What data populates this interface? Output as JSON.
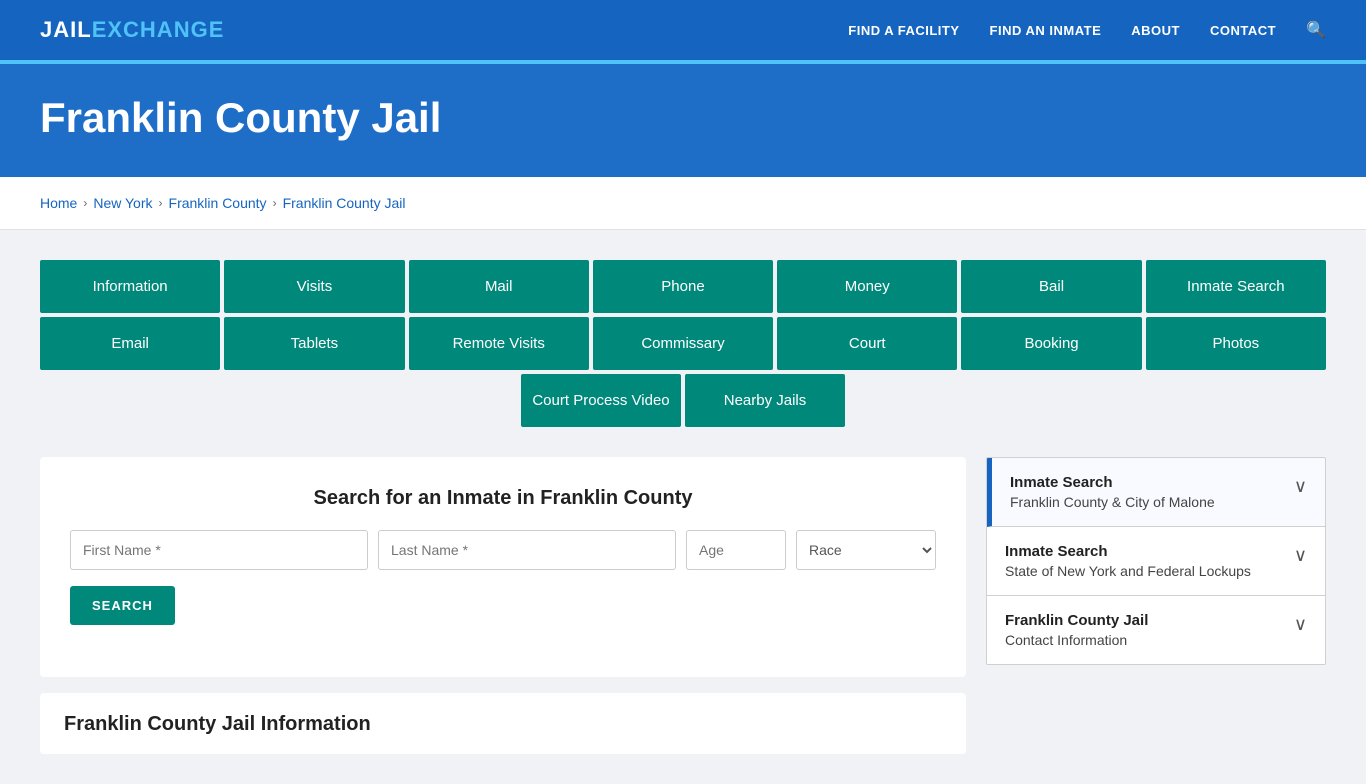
{
  "brand": {
    "jail": "JAIL",
    "exchange": "EXCHANGE"
  },
  "nav": {
    "links": [
      {
        "id": "find-facility",
        "label": "FIND A FACILITY"
      },
      {
        "id": "find-inmate",
        "label": "FIND AN INMATE"
      },
      {
        "id": "about",
        "label": "ABOUT"
      },
      {
        "id": "contact",
        "label": "CONTACT"
      }
    ]
  },
  "hero": {
    "title": "Franklin County Jail"
  },
  "breadcrumb": {
    "items": [
      {
        "id": "home",
        "label": "Home"
      },
      {
        "id": "new-york",
        "label": "New York"
      },
      {
        "id": "franklin-county",
        "label": "Franklin County"
      },
      {
        "id": "franklin-county-jail",
        "label": "Franklin County Jail"
      }
    ]
  },
  "grid_buttons": {
    "row1": [
      {
        "id": "information",
        "label": "Information"
      },
      {
        "id": "visits",
        "label": "Visits"
      },
      {
        "id": "mail",
        "label": "Mail"
      },
      {
        "id": "phone",
        "label": "Phone"
      },
      {
        "id": "money",
        "label": "Money"
      },
      {
        "id": "bail",
        "label": "Bail"
      },
      {
        "id": "inmate-search",
        "label": "Inmate Search"
      }
    ],
    "row2": [
      {
        "id": "email",
        "label": "Email"
      },
      {
        "id": "tablets",
        "label": "Tablets"
      },
      {
        "id": "remote-visits",
        "label": "Remote Visits"
      },
      {
        "id": "commissary",
        "label": "Commissary"
      },
      {
        "id": "court",
        "label": "Court"
      },
      {
        "id": "booking",
        "label": "Booking"
      },
      {
        "id": "photos",
        "label": "Photos"
      }
    ],
    "row3": [
      {
        "id": "court-process-video",
        "label": "Court Process Video"
      },
      {
        "id": "nearby-jails",
        "label": "Nearby Jails"
      }
    ]
  },
  "search_panel": {
    "title": "Search for an Inmate in Franklin County",
    "fields": {
      "first_name": {
        "placeholder": "First Name *"
      },
      "last_name": {
        "placeholder": "Last Name *"
      },
      "age": {
        "placeholder": "Age"
      },
      "race": {
        "placeholder": "Race",
        "label": "Race"
      }
    },
    "button_label": "SEARCH"
  },
  "info_section": {
    "title": "Franklin County Jail Information"
  },
  "sidebar": {
    "items": [
      {
        "id": "inmate-search-franklin",
        "title": "Inmate Search",
        "subtitle": "Franklin County & City of Malone",
        "active": true
      },
      {
        "id": "inmate-search-ny",
        "title": "Inmate Search",
        "subtitle": "State of New York and Federal Lockups",
        "active": false
      },
      {
        "id": "contact-info",
        "title": "Franklin County Jail",
        "subtitle": "Contact Information",
        "active": false
      }
    ]
  }
}
